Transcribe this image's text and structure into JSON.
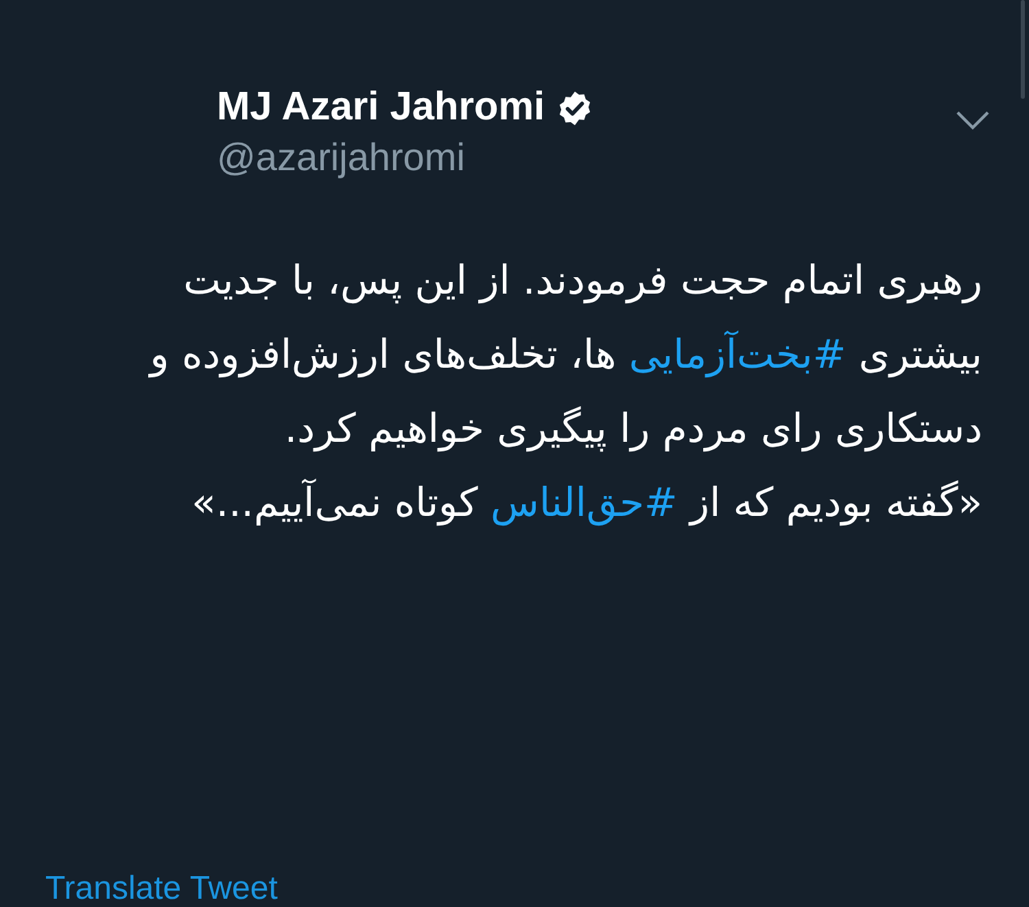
{
  "author": {
    "name": "MJ Azari Jahromi",
    "verified": true,
    "handle": "@azarijahromi"
  },
  "body": [
    [
      {
        "kind": "text",
        "text": "رهبری اتمام حجت فرمودند. از این پس، با جدیت بیشتری "
      },
      {
        "kind": "hashtag",
        "text": "#بخت‌آزمایی"
      },
      {
        "kind": "text",
        "text": " ها، تخلف‌های ارزش‌افزوده و دستکاری رای مردم را پیگیری خواهیم کرد."
      }
    ],
    [
      {
        "kind": "text",
        "text": "«گفته بودیم که از  "
      },
      {
        "kind": "hashtag",
        "text": "#حق‌الناس"
      },
      {
        "kind": "text",
        "text": " کوتاه نمی‌آییم...»"
      }
    ]
  ],
  "translate_link": "Translate Tweet"
}
